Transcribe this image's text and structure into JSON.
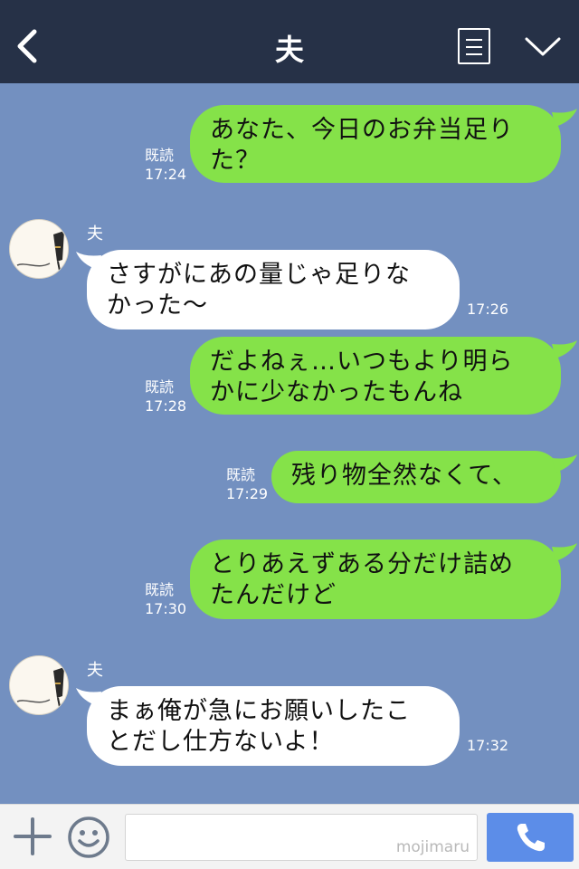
{
  "header": {
    "title": "夫"
  },
  "messages": [
    {
      "side": "sent",
      "text": "あなた、今日のお弁当足り\nた？",
      "read": "既読",
      "time": "17:24"
    },
    {
      "side": "recv",
      "sender": "夫",
      "text": "さすがにあの量じゃ足りな\nかった〜",
      "time": "17:26"
    },
    {
      "side": "sent",
      "text": "だよねぇ…いつもより明ら\nかに少なかったもんね",
      "read": "既読",
      "time": "17:28"
    },
    {
      "side": "sent",
      "text": "残り物全然なくて、",
      "read": "既読",
      "time": "17:29"
    },
    {
      "side": "sent",
      "text": "とりあえずある分だけ詰め\nたんだけど",
      "read": "既読",
      "time": "17:30"
    },
    {
      "side": "recv",
      "sender": "夫",
      "text": "まぁ俺が急にお願いしたこ\nとだし仕方ないよ！",
      "time": "17:32"
    }
  ],
  "footer": {
    "input_placeholder": "",
    "watermark": "mojimaru"
  },
  "colors": {
    "header": "#263147",
    "background": "#7390c0",
    "sent_bubble": "#85e249",
    "recv_bubble": "#ffffff",
    "call_button": "#5c8de8"
  },
  "icons": [
    "back-icon",
    "menu-icon",
    "chevron-down-icon",
    "plus-icon",
    "smile-icon",
    "phone-icon"
  ]
}
